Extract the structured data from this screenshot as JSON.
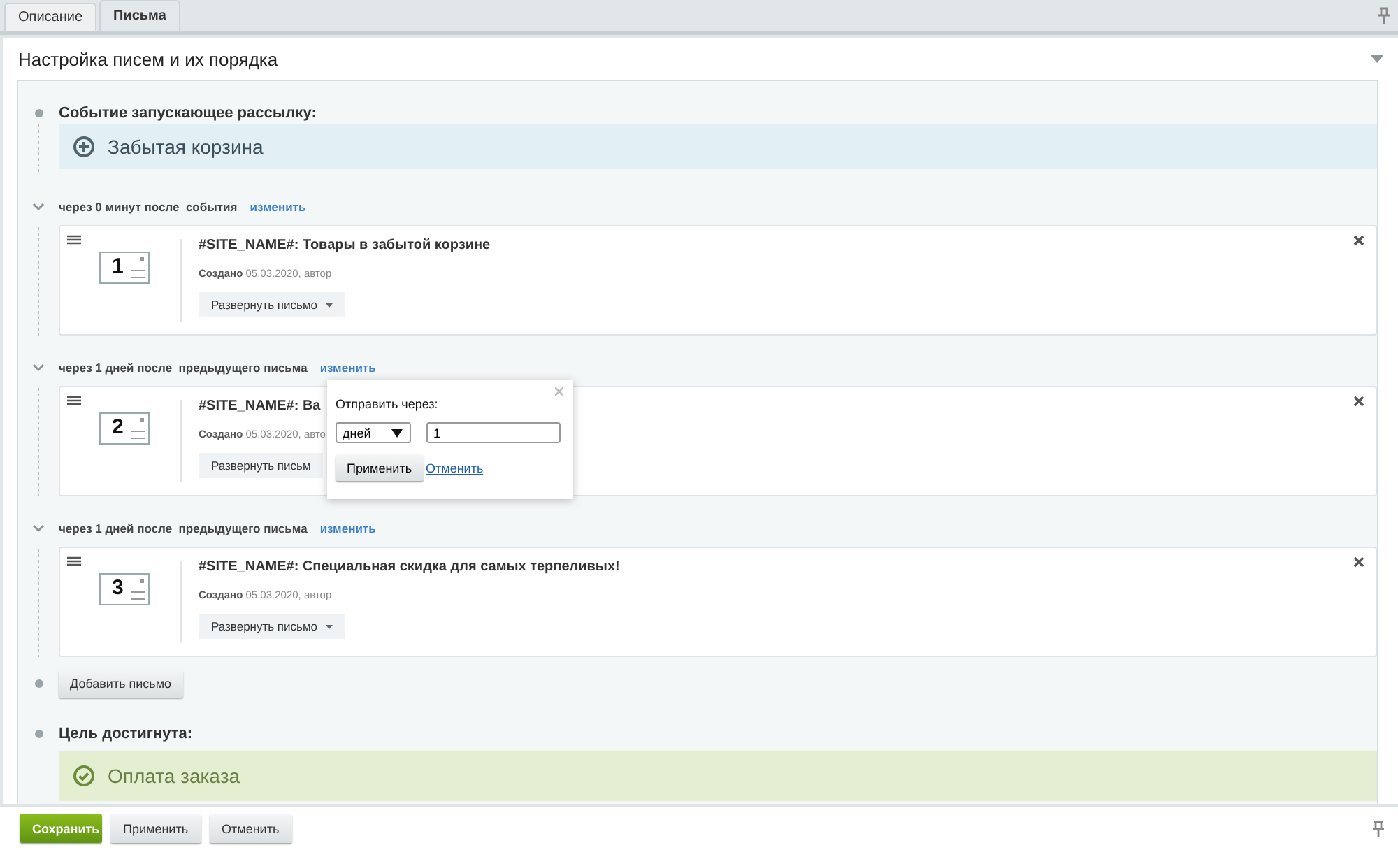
{
  "tabs": [
    {
      "label": "Описание",
      "selected": false
    },
    {
      "label": "Письма",
      "selected": true
    }
  ],
  "section": {
    "title": "Настройка писем и их порядка"
  },
  "trigger": {
    "label": "Событие запускающее рассылку:",
    "name": "Забытая корзина"
  },
  "letters": [
    {
      "delay": "через 0 минут после  события",
      "change": "изменить",
      "number": "1",
      "title": "#SITE_NAME#: Товары в забытой корзине",
      "created_label": "Создано",
      "created_value": "05.03.2020, автор",
      "expand": "Развернуть письмо",
      "show_caret": true
    },
    {
      "delay": "через 1 дней после  предыдущего письма",
      "change": "изменить",
      "number": "2",
      "title": "#SITE_NAME#: Ва",
      "created_label": "Создано",
      "created_value": "05.03.2020, авто",
      "expand": "Развернуть письм",
      "show_caret": false
    },
    {
      "delay": "через 1 дней после  предыдущего письма",
      "change": "изменить",
      "number": "3",
      "title": "#SITE_NAME#: Специальная скидка для самых терпеливых!",
      "created_label": "Создано",
      "created_value": "05.03.2020, автор",
      "expand": "Развернуть письмо",
      "show_caret": true
    }
  ],
  "popup": {
    "title": "Отправить через:",
    "unit": "дней",
    "value": "1",
    "apply": "Применить",
    "cancel": "Отменить"
  },
  "add_button": "Добавить письмо",
  "goal": {
    "label": "Цель достигнута:",
    "name": "Оплата заказа"
  },
  "footer": {
    "save": "Сохранить",
    "apply": "Применить",
    "cancel": "Отменить"
  }
}
